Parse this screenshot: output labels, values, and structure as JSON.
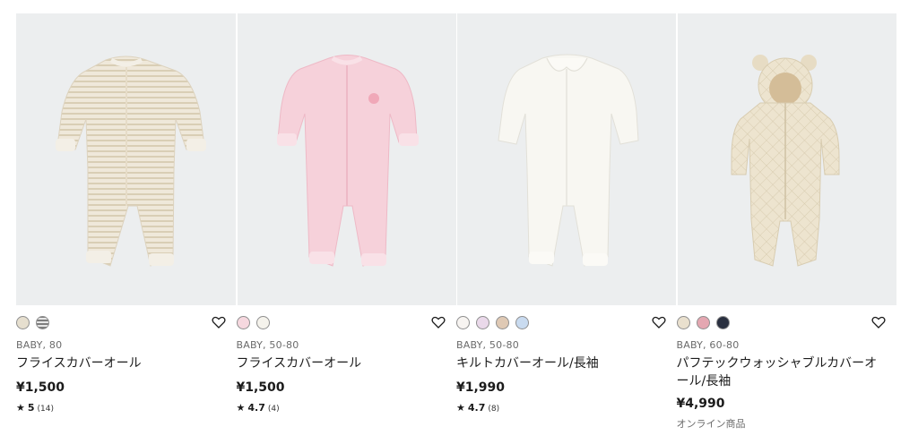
{
  "products": [
    {
      "category": "BABY, 80",
      "name": "フライスカバーオール",
      "price": "¥1,500",
      "rating": "5",
      "review_count": "(14)",
      "swatches": [
        "#e6dfcf",
        "#8f8f8f"
      ],
      "icon": "heart-icon"
    },
    {
      "category": "BABY, 50-80",
      "name": "フライスカバーオール",
      "price": "¥1,500",
      "rating": "4.7",
      "review_count": "(4)",
      "swatches": [
        "#f6d8df",
        "#f5f3ec"
      ],
      "icon": "heart-icon"
    },
    {
      "category": "BABY, 50-80",
      "name": "キルトカバーオール/長袖",
      "price": "¥1,990",
      "rating": "4.7",
      "review_count": "(8)",
      "swatches": [
        "#f7f4f1",
        "#ead9ea",
        "#dfc9b4",
        "#c9dbf0"
      ],
      "icon": "heart-icon"
    },
    {
      "category": "BABY, 60-80",
      "name": "パフテックウォッシャブルカバーオール/長袖",
      "price": "¥4,990",
      "note": "オンライン商品",
      "swatches": [
        "#e9e0ce",
        "#e4a7b1",
        "#2a3040"
      ],
      "icon": "heart-icon"
    }
  ]
}
